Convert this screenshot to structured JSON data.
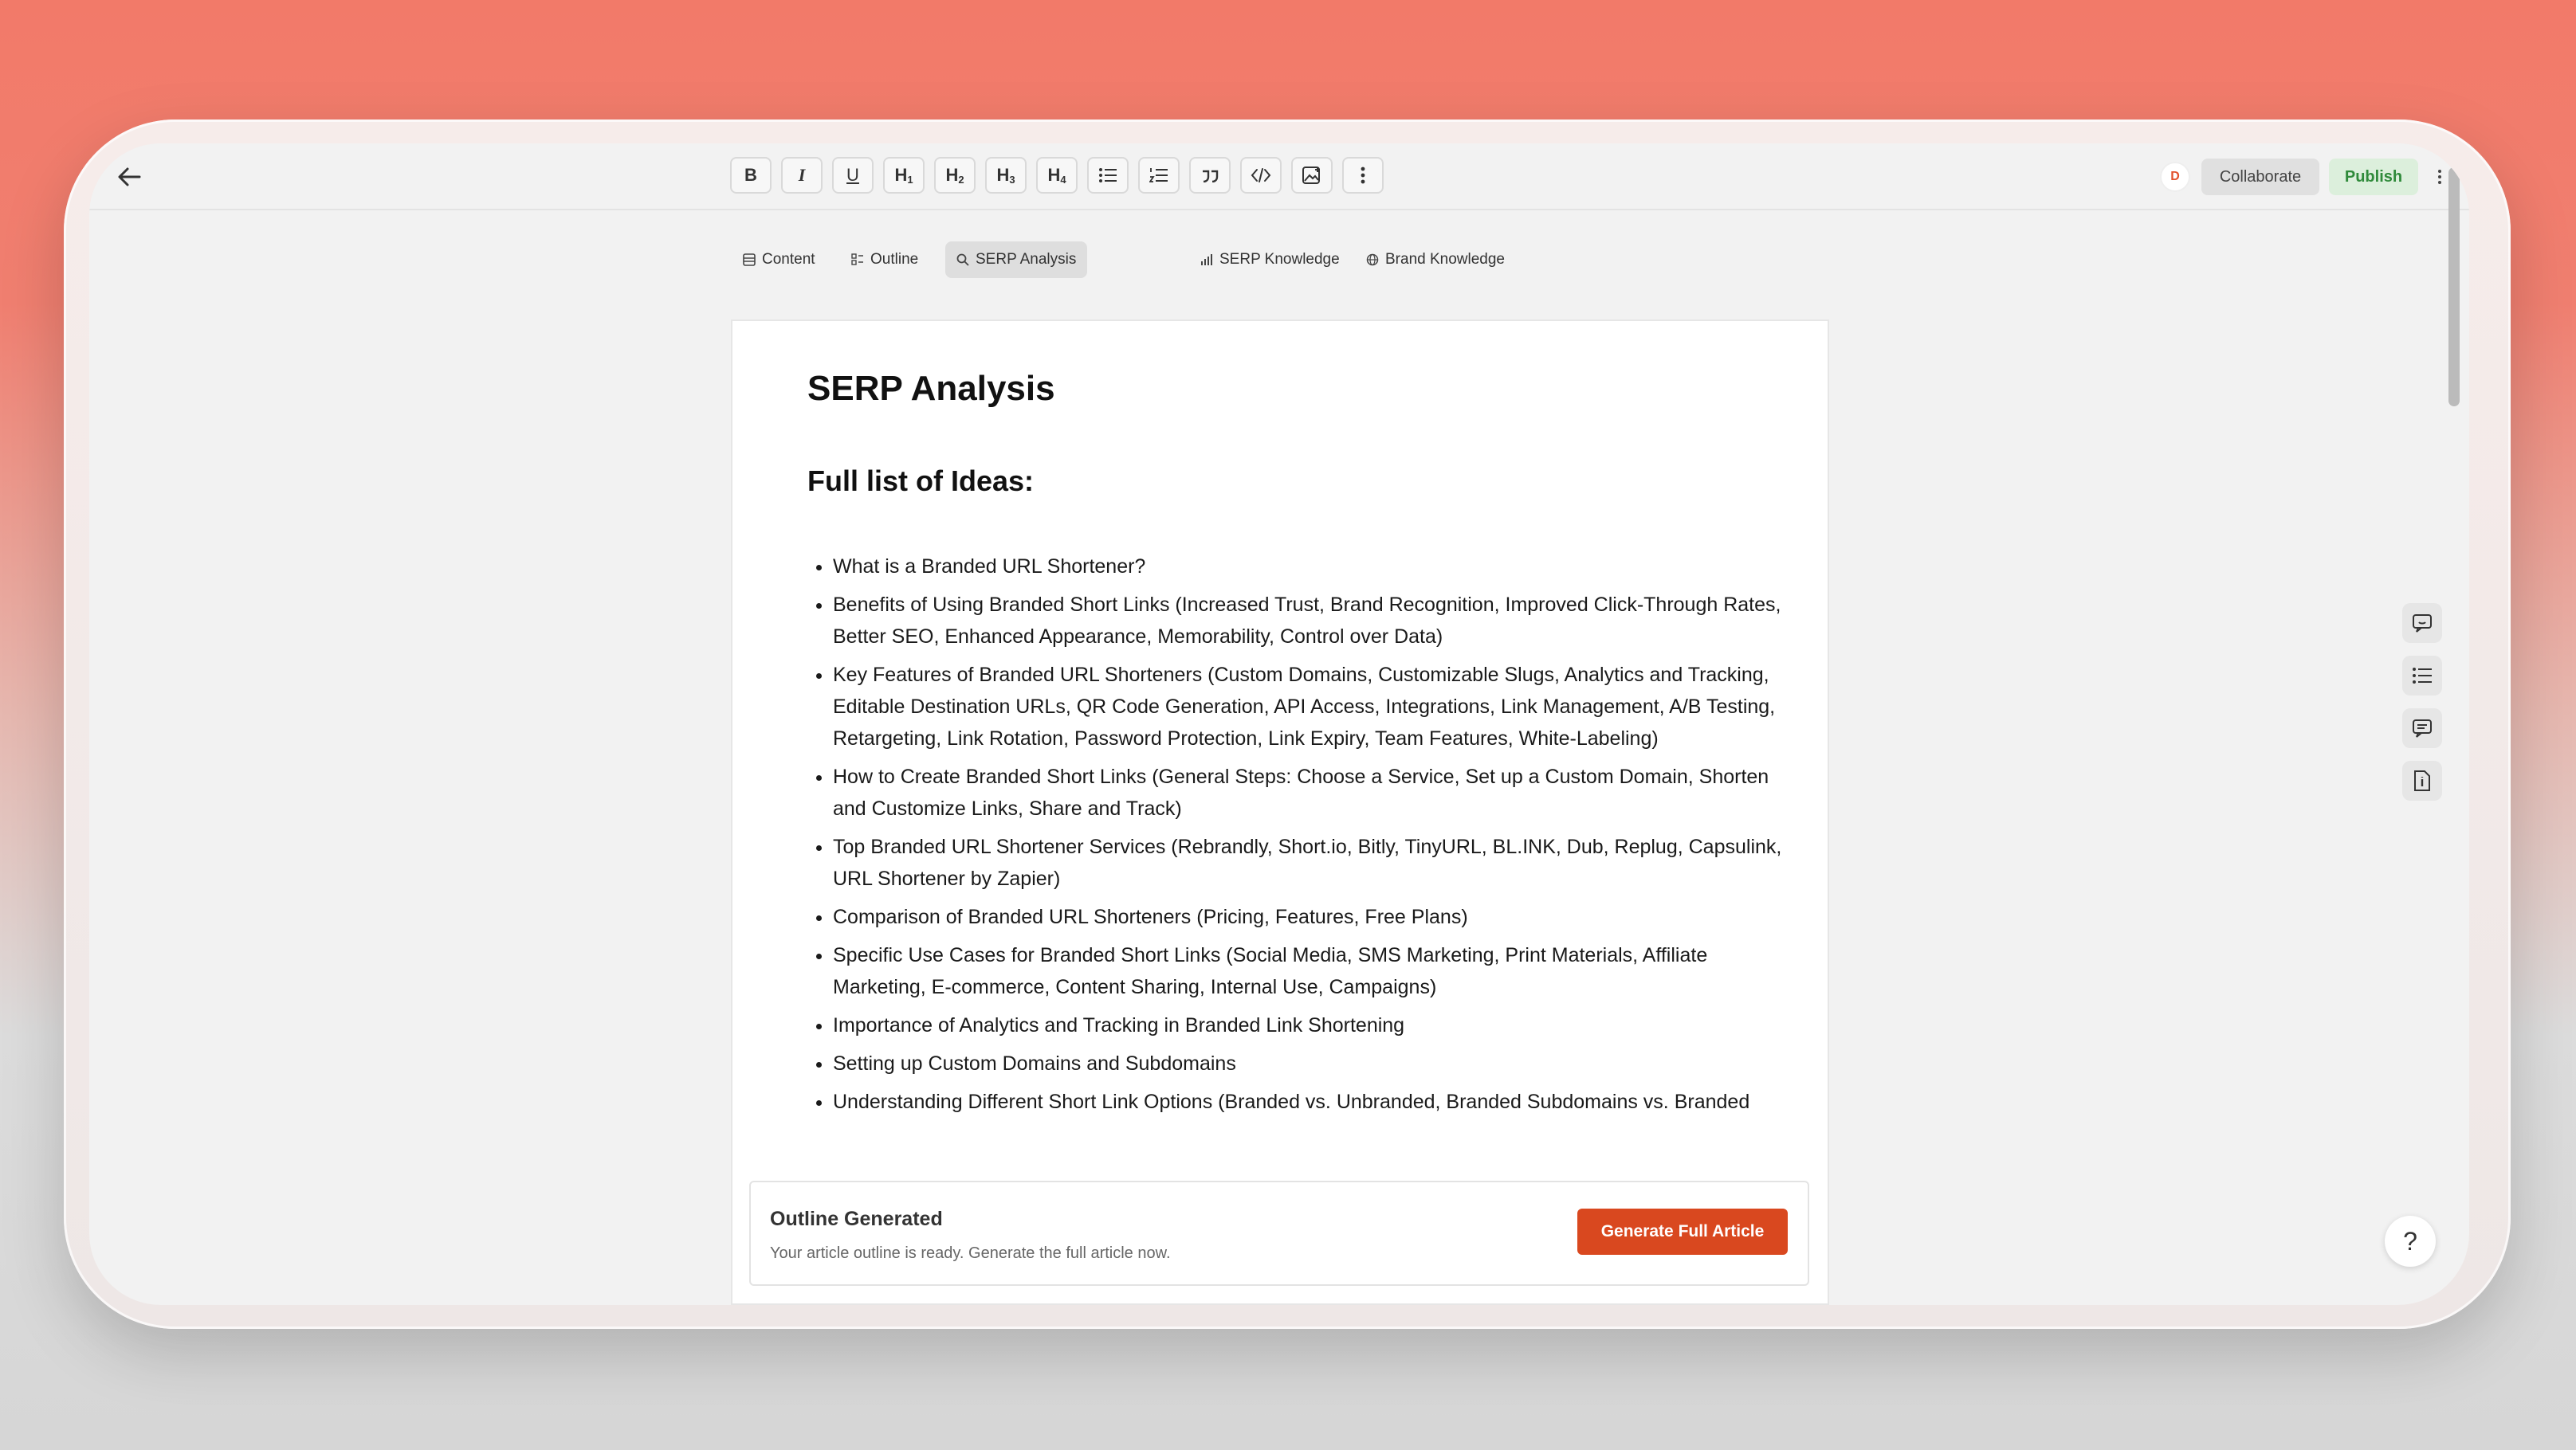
{
  "toolbar": {
    "h1": "H",
    "h2": "H",
    "h3": "H",
    "h4": "H",
    "h1n": "1",
    "h2n": "2",
    "h3n": "3",
    "h4n": "4",
    "bold": "B",
    "italic": "I",
    "underline": "U"
  },
  "header": {
    "avatar_letter": "D",
    "collaborate_label": "Collaborate",
    "publish_label": "Publish"
  },
  "tabs": [
    {
      "label": "Content",
      "icon": "table-icon"
    },
    {
      "label": "Outline",
      "icon": "outline-icon"
    },
    {
      "label": "SERP Analysis",
      "icon": "search-icon",
      "active": true
    },
    {
      "label": "SERP Knowledge",
      "icon": "bar-chart-icon"
    },
    {
      "label": "Brand Knowledge",
      "icon": "globe-icon"
    }
  ],
  "document": {
    "title": "SERP Analysis",
    "subtitle": "Full list of Ideas:",
    "ideas": [
      "What is a Branded URL Shortener?",
      "Benefits of Using Branded Short Links (Increased Trust, Brand Recognition, Improved Click-Through Rates, Better SEO, Enhanced Appearance, Memorability, Control over Data)",
      "Key Features of Branded URL Shorteners (Custom Domains, Customizable Slugs, Analytics and Tracking, Editable Destination URLs, QR Code Generation, API Access, Integrations, Link Management, A/B Testing, Retargeting, Link Rotation, Password Protection, Link Expiry, Team Features, White-Labeling)",
      "How to Create Branded Short Links (General Steps: Choose a Service, Set up a Custom Domain, Shorten and Customize Links, Share and Track)",
      "Top Branded URL Shortener Services (Rebrandly, Short.io, Bitly, TinyURL, BL.INK, Dub, Replug, Capsulink, URL Shortener by Zapier)",
      "Comparison of Branded URL Shorteners (Pricing, Features, Free Plans)",
      "Specific Use Cases for Branded Short Links (Social Media, SMS Marketing, Print Materials, Affiliate Marketing, E-commerce, Content Sharing, Internal Use, Campaigns)",
      "Importance of Analytics and Tracking in Branded Link Shortening",
      "Setting up Custom Domains and Subdomains",
      "Understanding Different Short Link Options (Branded vs. Unbranded, Branded Subdomains vs. Branded"
    ]
  },
  "banner": {
    "title": "Outline Generated",
    "text": "Your article outline is ready. Generate the full article now.",
    "button_label": "Generate Full Article"
  },
  "help_label": "?",
  "colors": {
    "accent": "#d9481f",
    "publish_bg": "#dcefdc",
    "publish_text": "#2f8a3a"
  }
}
